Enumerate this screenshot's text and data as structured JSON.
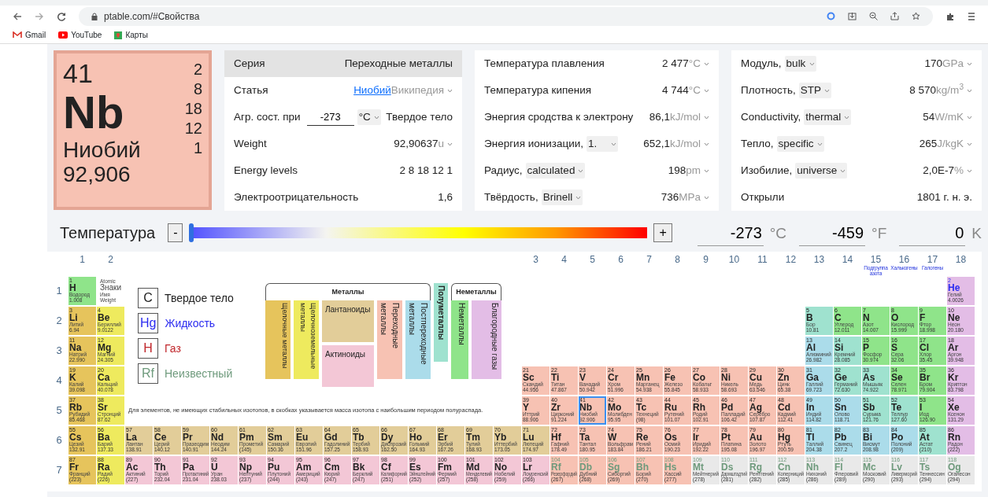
{
  "browser": {
    "url": "ptable.com/#Свойства",
    "bookmarks": [
      {
        "label": "Gmail",
        "kind": "mail"
      },
      {
        "label": "YouTube",
        "kind": "video"
      },
      {
        "label": "Карты",
        "kind": "maps"
      }
    ]
  },
  "element_card": {
    "number": "41",
    "symbol": "Nb",
    "name": "Ниобий",
    "mass": "92,906",
    "color": "#f7c2b3",
    "shells": [
      "2",
      "8",
      "18",
      "12",
      "1"
    ]
  },
  "property_panels": [
    {
      "rows": [
        {
          "kind": "header",
          "label": "Серия",
          "value": "Переходные металлы"
        },
        {
          "kind": "link",
          "label": "Статья",
          "value": "Ниобий",
          "unit": "Википедия"
        },
        {
          "kind": "temperature",
          "label": "Агр. сост. при",
          "input": "-273",
          "select": "°C",
          "value": "Твердое тело"
        },
        {
          "kind": "plain",
          "label": "Weight",
          "value": "92,90637",
          "unit": "u"
        },
        {
          "kind": "plain",
          "label": "Energy levels",
          "value": "2 8 18 12 1"
        },
        {
          "kind": "plain",
          "label": "Электроотрицательность",
          "value": "1,6"
        }
      ]
    },
    {
      "rows": [
        {
          "kind": "plain",
          "label": "Температура плавления",
          "value": "2 477",
          "unit": "°C"
        },
        {
          "kind": "plain",
          "label": "Температура кипения",
          "value": "4 744",
          "unit": "°C"
        },
        {
          "kind": "plain",
          "label": "Энергия сродства к электрону",
          "value": "86,1",
          "unit": "kJ/mol"
        },
        {
          "kind": "plain",
          "label": "Энергия ионизации,",
          "select": "1.",
          "value": "652,1",
          "unit": "kJ/mol"
        },
        {
          "kind": "plain",
          "label": "Радиус,",
          "select": "calculated",
          "value": "198",
          "unit": "pm"
        },
        {
          "kind": "plain",
          "label": "Твёрдость,",
          "select": "Brinell",
          "value": "736",
          "unit": "MPa"
        }
      ]
    },
    {
      "rows": [
        {
          "kind": "plain",
          "label": "Модуль,",
          "select": "bulk",
          "value": "170",
          "unit": "GPa"
        },
        {
          "kind": "plain",
          "label": "Плотность,",
          "select": "STP",
          "value": "8 570",
          "unit": "kg/m$^{3}$"
        },
        {
          "kind": "plain",
          "label": "Conductivity,",
          "select": "thermal",
          "value": "54",
          "unit": "W/mK"
        },
        {
          "kind": "plain",
          "label": "Тепло,",
          "select": "specific",
          "value": "265",
          "unit": "J/kgK"
        },
        {
          "kind": "plain",
          "label": "Изобилие,",
          "select": "universe",
          "value": "2,0E-7",
          "unit": "%"
        },
        {
          "kind": "plain",
          "label": "Открыли",
          "value": "1801 г. н. э."
        }
      ]
    }
  ],
  "temperature_bar": {
    "label": "Температура",
    "minus": "-",
    "plus": "+",
    "level": 0,
    "readings": [
      {
        "value": "-273",
        "unit": "°C"
      },
      {
        "value": "-459",
        "unit": "°F"
      },
      {
        "value": "0",
        "unit": "K"
      }
    ]
  },
  "periodic_table": {
    "groups": [
      {
        "label": "1"
      },
      {
        "label": "2"
      },
      {
        "label": "3"
      },
      {
        "label": "4"
      },
      {
        "label": "5"
      },
      {
        "label": "6"
      },
      {
        "label": "7"
      },
      {
        "label": "8"
      },
      {
        "label": "9"
      },
      {
        "label": "10"
      },
      {
        "label": "11"
      },
      {
        "label": "12"
      },
      {
        "label": "13"
      },
      {
        "label": "14"
      },
      {
        "label": "15",
        "note": "Подгруппа азота"
      },
      {
        "label": "16",
        "note": "Халькогены"
      },
      {
        "label": "17",
        "note": "Галогены"
      },
      {
        "label": "18"
      }
    ],
    "key_cell": [
      "Atomic",
      "Знаки",
      "Имя",
      "Weight"
    ],
    "states_legend": [
      {
        "kind": "solid",
        "symbol": "C",
        "label": "Твердое тело"
      },
      {
        "kind": "liquid",
        "symbol": "Hg",
        "label": "Жидкость"
      },
      {
        "kind": "gas",
        "symbol": "H",
        "label": "Газ"
      },
      {
        "kind": "unknown",
        "symbol": "Rf",
        "label": "Неизвестный"
      }
    ],
    "category_legend": {
      "metals_header": "Металлы",
      "nonmetals_header": "Неметаллы",
      "categories": [
        {
          "kind": "alkali",
          "label": "Щелочные металлы",
          "color": "#e6c45c"
        },
        {
          "kind": "alkaline",
          "label": "Щелочноземельные металлы",
          "color": "#eeea5e"
        },
        {
          "kind": "lanthanide",
          "label": "Лантаноиды",
          "color": "#e2cd99"
        },
        {
          "kind": "actinide",
          "label": "Актиноиды",
          "color": "#f3c7d6"
        },
        {
          "kind": "transition",
          "label": "Переходные металлы",
          "color": "#f7c2b3"
        },
        {
          "kind": "post",
          "label": "Постпереходные металлы",
          "color": "#abdcea"
        },
        {
          "kind": "metalloid",
          "label": "Полуметаллы",
          "color": "#9fe2cf"
        },
        {
          "kind": "nonmetal",
          "label": "Неметаллы",
          "color": "#8fe48a"
        },
        {
          "kind": "noble",
          "label": "Благородные газы",
          "color": "#e3bde6"
        }
      ]
    },
    "note": "Для элементов, не имеющих стабильных изотопов, в скобках указывается масса изотопа с наибольшим периодом полураспада.",
    "periods": [
      {
        "label": "1",
        "elements": [
          {
            "number": "1",
            "symbol": "H",
            "name": "Водород",
            "mass": "1.008",
            "color": "#8fe48a",
            "kind": "solid",
            "selected": false
          },
          {
            "number": "2",
            "symbol": "He",
            "name": "Гелий",
            "mass": "4.0026",
            "color": "#e3bde6",
            "kind": "liquid",
            "selected": false
          }
        ]
      },
      {
        "label": "2",
        "elements": [
          {
            "number": "3",
            "symbol": "Li",
            "name": "Литий",
            "mass": "6.94",
            "color": "#e6c45c",
            "kind": "solid",
            "selected": false
          },
          {
            "number": "4",
            "symbol": "Be",
            "name": "Бериллий",
            "mass": "9.0122",
            "color": "#eeea5e",
            "kind": "solid",
            "selected": false
          },
          {
            "number": "5",
            "symbol": "B",
            "name": "Бор",
            "mass": "10.81",
            "color": "#9fe2cf",
            "kind": "solid",
            "selected": false
          },
          {
            "number": "6",
            "symbol": "C",
            "name": "Углерод",
            "mass": "12.011",
            "color": "#8fe48a",
            "kind": "solid",
            "selected": false
          },
          {
            "number": "7",
            "symbol": "N",
            "name": "Азот",
            "mass": "14.007",
            "color": "#8fe48a",
            "kind": "solid",
            "selected": false
          },
          {
            "number": "8",
            "symbol": "O",
            "name": "Кислород",
            "mass": "15.999",
            "color": "#8fe48a",
            "kind": "solid",
            "selected": false
          },
          {
            "number": "9",
            "symbol": "F",
            "name": "Фтор",
            "mass": "18.998",
            "color": "#8fe48a",
            "kind": "solid",
            "selected": false
          },
          {
            "number": "10",
            "symbol": "Ne",
            "name": "Неон",
            "mass": "20.180",
            "color": "#e3bde6",
            "kind": "solid",
            "selected": false
          }
        ]
      },
      {
        "label": "3",
        "elements": [
          {
            "number": "11",
            "symbol": "Na",
            "name": "Натрий",
            "mass": "22.990",
            "color": "#e6c45c",
            "kind": "solid",
            "selected": false
          },
          {
            "number": "12",
            "symbol": "Mg",
            "name": "Магний",
            "mass": "24.305",
            "color": "#eeea5e",
            "kind": "solid",
            "selected": false
          },
          {
            "number": "13",
            "symbol": "Al",
            "name": "Алюминий",
            "mass": "26.982",
            "color": "#abdcea",
            "kind": "solid",
            "selected": false
          },
          {
            "number": "14",
            "symbol": "Si",
            "name": "Кремний",
            "mass": "28.085",
            "color": "#9fe2cf",
            "kind": "solid",
            "selected": false
          },
          {
            "number": "15",
            "symbol": "P",
            "name": "Фосфор",
            "mass": "30.974",
            "color": "#8fe48a",
            "kind": "solid",
            "selected": false
          },
          {
            "number": "16",
            "symbol": "S",
            "name": "Сера",
            "mass": "32.06",
            "color": "#8fe48a",
            "kind": "solid",
            "selected": false
          },
          {
            "number": "17",
            "symbol": "Cl",
            "name": "Хлор",
            "mass": "35.45",
            "color": "#8fe48a",
            "kind": "solid",
            "selected": false
          },
          {
            "number": "18",
            "symbol": "Ar",
            "name": "Аргон",
            "mass": "39.948",
            "color": "#e3bde6",
            "kind": "solid",
            "selected": false
          }
        ]
      },
      {
        "label": "4",
        "elements": [
          {
            "number": "19",
            "symbol": "K",
            "name": "Калий",
            "mass": "39.098",
            "color": "#e6c45c",
            "kind": "solid",
            "selected": false
          },
          {
            "number": "20",
            "symbol": "Ca",
            "name": "Кальций",
            "mass": "40.078",
            "color": "#eeea5e",
            "kind": "solid",
            "selected": false
          },
          {
            "number": "21",
            "symbol": "Sc",
            "name": "Скандий",
            "mass": "44.956",
            "color": "#f7c2b3",
            "kind": "solid",
            "selected": false
          },
          {
            "number": "22",
            "symbol": "Ti",
            "name": "Титан",
            "mass": "47.867",
            "color": "#f7c2b3",
            "kind": "solid",
            "selected": false
          },
          {
            "number": "23",
            "symbol": "V",
            "name": "Ванадий",
            "mass": "50.942",
            "color": "#f7c2b3",
            "kind": "solid",
            "selected": false
          },
          {
            "number": "24",
            "symbol": "Cr",
            "name": "Хром",
            "mass": "51.996",
            "color": "#f7c2b3",
            "kind": "solid",
            "selected": false
          },
          {
            "number": "25",
            "symbol": "Mn",
            "name": "Марганец",
            "mass": "54.938",
            "color": "#f7c2b3",
            "kind": "solid",
            "selected": false
          },
          {
            "number": "26",
            "symbol": "Fe",
            "name": "Железо",
            "mass": "55.845",
            "color": "#f7c2b3",
            "kind": "solid",
            "selected": false
          },
          {
            "number": "27",
            "symbol": "Co",
            "name": "Кобальт",
            "mass": "58.933",
            "color": "#f7c2b3",
            "kind": "solid",
            "selected": false
          },
          {
            "number": "28",
            "symbol": "Ni",
            "name": "Никель",
            "mass": "58.693",
            "color": "#f7c2b3",
            "kind": "solid",
            "selected": false
          },
          {
            "number": "29",
            "symbol": "Cu",
            "name": "Медь",
            "mass": "63.546",
            "color": "#f7c2b3",
            "kind": "solid",
            "selected": false
          },
          {
            "number": "30",
            "symbol": "Zn",
            "name": "Цинк",
            "mass": "65.38",
            "color": "#f7c2b3",
            "kind": "solid",
            "selected": false
          },
          {
            "number": "31",
            "symbol": "Ga",
            "name": "Галлий",
            "mass": "69.723",
            "color": "#abdcea",
            "kind": "solid",
            "selected": false
          },
          {
            "number": "32",
            "symbol": "Ge",
            "name": "Германий",
            "mass": "72.630",
            "color": "#9fe2cf",
            "kind": "solid",
            "selected": false
          },
          {
            "number": "33",
            "symbol": "As",
            "name": "Мышьяк",
            "mass": "74.922",
            "color": "#9fe2cf",
            "kind": "solid",
            "selected": false
          },
          {
            "number": "34",
            "symbol": "Se",
            "name": "Селен",
            "mass": "78.971",
            "color": "#8fe48a",
            "kind": "solid",
            "selected": false
          },
          {
            "number": "35",
            "symbol": "Br",
            "name": "Бром",
            "mass": "79.904",
            "color": "#8fe48a",
            "kind": "solid",
            "selected": false
          },
          {
            "number": "36",
            "symbol": "Kr",
            "name": "Криптон",
            "mass": "83.798",
            "color": "#e3bde6",
            "kind": "solid",
            "selected": false
          }
        ]
      },
      {
        "label": "5",
        "elements": [
          {
            "number": "37",
            "symbol": "Rb",
            "name": "Рубидий",
            "mass": "85.468",
            "color": "#e6c45c",
            "kind": "solid",
            "selected": false
          },
          {
            "number": "38",
            "symbol": "Sr",
            "name": "Стронций",
            "mass": "87.62",
            "color": "#eeea5e",
            "kind": "solid",
            "selected": false
          },
          {
            "number": "39",
            "symbol": "Y",
            "name": "Иттрий",
            "mass": "88.906",
            "color": "#f7c2b3",
            "kind": "solid",
            "selected": false
          },
          {
            "number": "40",
            "symbol": "Zr",
            "name": "Цирконий",
            "mass": "91.224",
            "color": "#f7c2b3",
            "kind": "solid",
            "selected": false
          },
          {
            "number": "41",
            "symbol": "Nb",
            "name": "Ниобий",
            "mass": "92.906",
            "color": "#f7c2b3",
            "kind": "solid",
            "selected": true
          },
          {
            "number": "42",
            "symbol": "Mo",
            "name": "Молибден",
            "mass": "95.95",
            "color": "#f7c2b3",
            "kind": "solid",
            "selected": false
          },
          {
            "number": "43",
            "symbol": "Tc",
            "name": "Технеций",
            "mass": "(98)",
            "color": "#f7c2b3",
            "kind": "solid",
            "selected": false
          },
          {
            "number": "44",
            "symbol": "Ru",
            "name": "Рутений",
            "mass": "101.07",
            "color": "#f7c2b3",
            "kind": "solid",
            "selected": false
          },
          {
            "number": "45",
            "symbol": "Rh",
            "name": "Родий",
            "mass": "102.91",
            "color": "#f7c2b3",
            "kind": "solid",
            "selected": false
          },
          {
            "number": "46",
            "symbol": "Pd",
            "name": "Палладий",
            "mass": "106.42",
            "color": "#f7c2b3",
            "kind": "solid",
            "selected": false
          },
          {
            "number": "47",
            "symbol": "Ag",
            "name": "Серебро",
            "mass": "107.87",
            "color": "#f7c2b3",
            "kind": "solid",
            "selected": false
          },
          {
            "number": "48",
            "symbol": "Cd",
            "name": "Кадмий",
            "mass": "112.41",
            "color": "#f7c2b3",
            "kind": "solid",
            "selected": false
          },
          {
            "number": "49",
            "symbol": "In",
            "name": "Индий",
            "mass": "114.82",
            "color": "#abdcea",
            "kind": "solid",
            "selected": false
          },
          {
            "number": "50",
            "symbol": "Sn",
            "name": "Олово",
            "mass": "118.71",
            "color": "#abdcea",
            "kind": "solid",
            "selected": false
          },
          {
            "number": "51",
            "symbol": "Sb",
            "name": "Сурьма",
            "mass": "121.76",
            "color": "#9fe2cf",
            "kind": "solid",
            "selected": false
          },
          {
            "number": "52",
            "symbol": "Te",
            "name": "Теллур",
            "mass": "127.60",
            "color": "#9fe2cf",
            "kind": "solid",
            "selected": false
          },
          {
            "number": "53",
            "symbol": "I",
            "name": "Иод",
            "mass": "126.90",
            "color": "#8fe48a",
            "kind": "solid",
            "selected": false
          },
          {
            "number": "54",
            "symbol": "Xe",
            "name": "Ксенон",
            "mass": "131.29",
            "color": "#e3bde6",
            "kind": "solid",
            "selected": false
          }
        ]
      },
      {
        "label": "6",
        "elements": [
          {
            "number": "55",
            "symbol": "Cs",
            "name": "Цезий",
            "mass": "132.91",
            "color": "#e6c45c",
            "kind": "solid",
            "selected": false
          },
          {
            "number": "56",
            "symbol": "Ba",
            "name": "Барий",
            "mass": "137.33",
            "color": "#eeea5e",
            "kind": "solid",
            "selected": false
          },
          {
            "number": "57",
            "symbol": "La",
            "name": "Лантан",
            "mass": "138.91",
            "color": "#e2cd99",
            "kind": "solid",
            "selected": false
          },
          {
            "number": "58",
            "symbol": "Ce",
            "name": "Церий",
            "mass": "140.12",
            "color": "#e2cd99",
            "kind": "solid",
            "selected": false
          },
          {
            "number": "59",
            "symbol": "Pr",
            "name": "Празеодим",
            "mass": "140.91",
            "color": "#e2cd99",
            "kind": "solid",
            "selected": false
          },
          {
            "number": "60",
            "symbol": "Nd",
            "name": "Неодим",
            "mass": "144.24",
            "color": "#e2cd99",
            "kind": "solid",
            "selected": false
          },
          {
            "number": "61",
            "symbol": "Pm",
            "name": "Прометий",
            "mass": "(145)",
            "color": "#e2cd99",
            "kind": "solid",
            "selected": false
          },
          {
            "number": "62",
            "symbol": "Sm",
            "name": "Самарий",
            "mass": "150.36",
            "color": "#e2cd99",
            "kind": "solid",
            "selected": false
          },
          {
            "number": "63",
            "symbol": "Eu",
            "name": "Европий",
            "mass": "151.96",
            "color": "#e2cd99",
            "kind": "solid",
            "selected": false
          },
          {
            "number": "64",
            "symbol": "Gd",
            "name": "Гадолиний",
            "mass": "157.25",
            "color": "#e2cd99",
            "kind": "solid",
            "selected": false
          },
          {
            "number": "65",
            "symbol": "Tb",
            "name": "Тербий",
            "mass": "158.93",
            "color": "#e2cd99",
            "kind": "solid",
            "selected": false
          },
          {
            "number": "66",
            "symbol": "Dy",
            "name": "Диспрозий",
            "mass": "162.50",
            "color": "#e2cd99",
            "kind": "solid",
            "selected": false
          },
          {
            "number": "67",
            "symbol": "Ho",
            "name": "Гольмий",
            "mass": "164.93",
            "color": "#e2cd99",
            "kind": "solid",
            "selected": false
          },
          {
            "number": "68",
            "symbol": "Er",
            "name": "Эрбий",
            "mass": "167.26",
            "color": "#e2cd99",
            "kind": "solid",
            "selected": false
          },
          {
            "number": "69",
            "symbol": "Tm",
            "name": "Тулий",
            "mass": "168.93",
            "color": "#e2cd99",
            "kind": "solid",
            "selected": false
          },
          {
            "number": "70",
            "symbol": "Yb",
            "name": "Иттербий",
            "mass": "173.05",
            "color": "#e2cd99",
            "kind": "solid",
            "selected": false
          },
          {
            "number": "71",
            "symbol": "Lu",
            "name": "Лютеций",
            "mass": "174.97",
            "color": "#e2cd99",
            "kind": "solid",
            "selected": false
          },
          {
            "number": "72",
            "symbol": "Hf",
            "name": "Гафний",
            "mass": "178.49",
            "color": "#f7c2b3",
            "kind": "solid",
            "selected": false
          },
          {
            "number": "73",
            "symbol": "Ta",
            "name": "Тантал",
            "mass": "180.95",
            "color": "#f7c2b3",
            "kind": "solid",
            "selected": false
          },
          {
            "number": "74",
            "symbol": "W",
            "name": "Вольфрам",
            "mass": "183.84",
            "color": "#f7c2b3",
            "kind": "solid",
            "selected": false
          },
          {
            "number": "75",
            "symbol": "Re",
            "name": "Рений",
            "mass": "186.21",
            "color": "#f7c2b3",
            "kind": "solid",
            "selected": false
          },
          {
            "number": "76",
            "symbol": "Os",
            "name": "Осмий",
            "mass": "190.23",
            "color": "#f7c2b3",
            "kind": "solid",
            "selected": false
          },
          {
            "number": "77",
            "symbol": "Ir",
            "name": "Иридий",
            "mass": "192.22",
            "color": "#f7c2b3",
            "kind": "solid",
            "selected": false
          },
          {
            "number": "78",
            "symbol": "Pt",
            "name": "Платина",
            "mass": "195.08",
            "color": "#f7c2b3",
            "kind": "solid",
            "selected": false
          },
          {
            "number": "79",
            "symbol": "Au",
            "name": "Золото",
            "mass": "196.97",
            "color": "#f7c2b3",
            "kind": "solid",
            "selected": false
          },
          {
            "number": "80",
            "symbol": "Hg",
            "name": "Ртуть",
            "mass": "200.59",
            "color": "#f7c2b3",
            "kind": "solid",
            "selected": false
          },
          {
            "number": "81",
            "symbol": "Tl",
            "name": "Таллий",
            "mass": "204.38",
            "color": "#abdcea",
            "kind": "solid",
            "selected": false
          },
          {
            "number": "82",
            "symbol": "Pb",
            "name": "Свинец",
            "mass": "207.2",
            "color": "#abdcea",
            "kind": "solid",
            "selected": false
          },
          {
            "number": "83",
            "symbol": "Bi",
            "name": "Висмут",
            "mass": "208.98",
            "color": "#abdcea",
            "kind": "solid",
            "selected": false
          },
          {
            "number": "84",
            "symbol": "Po",
            "name": "Полоний",
            "mass": "(209)",
            "color": "#abdcea",
            "kind": "solid",
            "selected": false
          },
          {
            "number": "85",
            "symbol": "At",
            "name": "Астат",
            "mass": "(210)",
            "color": "#9fe2cf",
            "kind": "solid",
            "selected": false
          },
          {
            "number": "86",
            "symbol": "Rn",
            "name": "Радон",
            "mass": "(222)",
            "color": "#e3bde6",
            "kind": "solid",
            "selected": false
          }
        ]
      },
      {
        "label": "7",
        "elements": [
          {
            "number": "87",
            "symbol": "Fr",
            "name": "Франций",
            "mass": "(223)",
            "color": "#e6c45c",
            "kind": "solid",
            "selected": false
          },
          {
            "number": "88",
            "symbol": "Ra",
            "name": "Радий",
            "mass": "(226)",
            "color": "#eeea5e",
            "kind": "solid",
            "selected": false
          },
          {
            "number": "89",
            "symbol": "Ac",
            "name": "Актиний",
            "mass": "(227)",
            "color": "#f3c7d6",
            "kind": "solid",
            "selected": false
          },
          {
            "number": "90",
            "symbol": "Th",
            "name": "Торий",
            "mass": "232.04",
            "color": "#f3c7d6",
            "kind": "solid",
            "selected": false
          },
          {
            "number": "91",
            "symbol": "Pa",
            "name": "Протактиний",
            "mass": "231.04",
            "color": "#f3c7d6",
            "kind": "solid",
            "selected": false
          },
          {
            "number": "92",
            "symbol": "U",
            "name": "Уран",
            "mass": "238.03",
            "color": "#f3c7d6",
            "kind": "solid",
            "selected": false
          },
          {
            "number": "93",
            "symbol": "Np",
            "name": "Нептуний",
            "mass": "(237)",
            "color": "#f3c7d6",
            "kind": "solid",
            "selected": false
          },
          {
            "number": "94",
            "symbol": "Pu",
            "name": "Плутоний",
            "mass": "(244)",
            "color": "#f3c7d6",
            "kind": "solid",
            "selected": false
          },
          {
            "number": "95",
            "symbol": "Am",
            "name": "Америций",
            "mass": "(243)",
            "color": "#f3c7d6",
            "kind": "solid",
            "selected": false
          },
          {
            "number": "96",
            "symbol": "Cm",
            "name": "Кюрий",
            "mass": "(247)",
            "color": "#f3c7d6",
            "kind": "solid",
            "selected": false
          },
          {
            "number": "97",
            "symbol": "Bk",
            "name": "Берклий",
            "mass": "(247)",
            "color": "#f3c7d6",
            "kind": "solid",
            "selected": false
          },
          {
            "number": "98",
            "symbol": "Cf",
            "name": "Калифорний",
            "mass": "(251)",
            "color": "#f3c7d6",
            "kind": "solid",
            "selected": false
          },
          {
            "number": "99",
            "symbol": "Es",
            "name": "Эйнштейний",
            "mass": "(252)",
            "color": "#f3c7d6",
            "kind": "solid",
            "selected": false
          },
          {
            "number": "100",
            "symbol": "Fm",
            "name": "Фермий",
            "mass": "(257)",
            "color": "#f3c7d6",
            "kind": "solid",
            "selected": false
          },
          {
            "number": "101",
            "symbol": "Md",
            "name": "Менделевий",
            "mass": "(258)",
            "color": "#f3c7d6",
            "kind": "solid",
            "selected": false
          },
          {
            "number": "102",
            "symbol": "No",
            "name": "Нобелий",
            "mass": "(259)",
            "color": "#f3c7d6",
            "kind": "solid",
            "selected": false
          },
          {
            "number": "103",
            "symbol": "Lr",
            "name": "Лоуренсий",
            "mass": "(266)",
            "color": "#f3c7d6",
            "kind": "solid",
            "selected": false
          },
          {
            "number": "104",
            "symbol": "Rf",
            "name": "Резерфордий",
            "mass": "(267)",
            "color": "#f7c2b3",
            "kind": "unknown",
            "selected": false
          },
          {
            "number": "105",
            "symbol": "Db",
            "name": "Дубний",
            "mass": "(268)",
            "color": "#f7c2b3",
            "kind": "unknown",
            "selected": false
          },
          {
            "number": "106",
            "symbol": "Sg",
            "name": "Сиборгий",
            "mass": "(269)",
            "color": "#f7c2b3",
            "kind": "unknown",
            "selected": false
          },
          {
            "number": "107",
            "symbol": "Bh",
            "name": "Борий",
            "mass": "(270)",
            "color": "#f7c2b3",
            "kind": "unknown",
            "selected": false
          },
          {
            "number": "108",
            "symbol": "Hs",
            "name": "Хассий",
            "mass": "(277)",
            "color": "#f7c2b3",
            "kind": "unknown",
            "selected": false
          },
          {
            "number": "109",
            "symbol": "Mt",
            "name": "Мейтнерий",
            "mass": "(278)",
            "color": "#e9e9e9",
            "kind": "unknown",
            "selected": false
          },
          {
            "number": "110",
            "symbol": "Ds",
            "name": "Дармштадтий",
            "mass": "(281)",
            "color": "#e9e9e9",
            "kind": "unknown",
            "selected": false
          },
          {
            "number": "111",
            "symbol": "Rg",
            "name": "Рентгений",
            "mass": "(282)",
            "color": "#e9e9e9",
            "kind": "unknown",
            "selected": false
          },
          {
            "number": "112",
            "symbol": "Cn",
            "name": "Коперниций",
            "mass": "(285)",
            "color": "#e9e9e9",
            "kind": "unknown",
            "selected": false
          },
          {
            "number": "113",
            "symbol": "Nh",
            "name": "Нихоний",
            "mass": "(286)",
            "color": "#e9e9e9",
            "kind": "unknown",
            "selected": false
          },
          {
            "number": "114",
            "symbol": "Fl",
            "name": "Флеровий",
            "mass": "(289)",
            "color": "#e9e9e9",
            "kind": "unknown",
            "selected": false
          },
          {
            "number": "115",
            "symbol": "Mc",
            "name": "Московий",
            "mass": "(290)",
            "color": "#e9e9e9",
            "kind": "unknown",
            "selected": false
          },
          {
            "number": "116",
            "symbol": "Lv",
            "name": "Ливерморий",
            "mass": "(293)",
            "color": "#e9e9e9",
            "kind": "unknown",
            "selected": false
          },
          {
            "number": "117",
            "symbol": "Ts",
            "name": "Теннессин",
            "mass": "(294)",
            "color": "#e9e9e9",
            "kind": "unknown",
            "selected": false
          },
          {
            "number": "118",
            "symbol": "Og",
            "name": "Оганесон",
            "mass": "(294)",
            "color": "#e9e9e9",
            "kind": "unknown",
            "selected": false
          }
        ]
      }
    ]
  }
}
